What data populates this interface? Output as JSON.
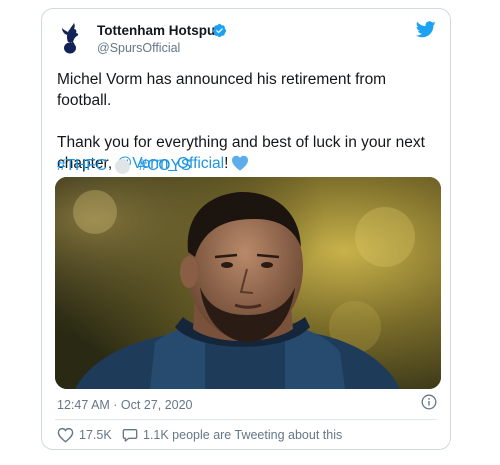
{
  "tweet": {
    "author": {
      "display_name": "Tottenham Hotspur",
      "handle": "@SpursOfficial",
      "verified": true
    },
    "text_line1": "Michel Vorm has announced his retirement from football.",
    "text_line2_prefix": "Thank you for everything and best of luck in your next chapter, ",
    "mention": "@Vorm_Official",
    "text_line2_suffix": "!",
    "hashtag1": "#THFC",
    "hashtag2": "#COYS",
    "timestamp": "12:47 AM · Oct 27, 2020",
    "likes": "17.5K",
    "replies_text": "1.1K people are Tweeting about this"
  },
  "icons": {
    "brand": "twitter-bird-icon",
    "verified": "verified-badge-icon",
    "heart_emoji": "blue-heart-emoji",
    "info": "info-icon",
    "like": "heart-icon",
    "reply": "speech-bubble-icon"
  },
  "colors": {
    "brand_blue": "#1da1f2",
    "link_blue": "#1b95e0",
    "like_red": "#e0245e",
    "muted_text": "#657786",
    "border": "#cfd9de"
  }
}
